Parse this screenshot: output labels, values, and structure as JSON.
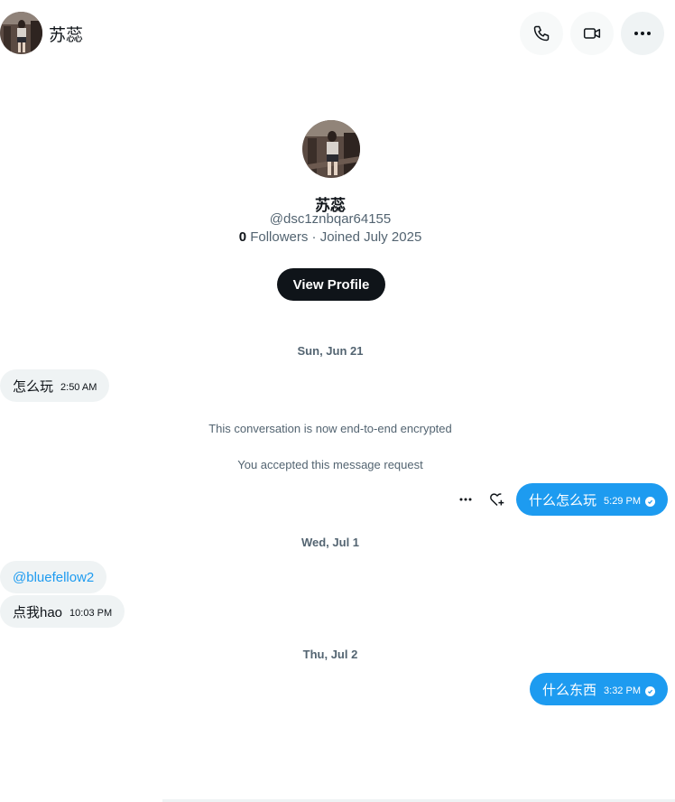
{
  "header": {
    "name": "苏蕊",
    "buttons": {
      "call": "phone-icon",
      "video": "video-icon",
      "more": "more-icon"
    }
  },
  "profile": {
    "name": "苏蕊",
    "handle": "@dsc1znbqar64155",
    "followers_count": "0",
    "followers_label": " Followers · Joined July 2025",
    "view_profile_label": "View Profile"
  },
  "dates": {
    "d1": "Sun, Jun 21",
    "d2": "Wed, Jul 1",
    "d3": "Thu, Jul 2"
  },
  "system_notes": {
    "encrypted": "This conversation is now end-to-end encrypted",
    "accepted": "You accepted this message request"
  },
  "messages": [
    {
      "text": "怎么玩",
      "time": "2:50 AM",
      "direction": "in"
    },
    {
      "text": "什么怎么玩",
      "time": "5:29 PM",
      "direction": "out"
    },
    {
      "text": "@bluefellow2",
      "time": "",
      "direction": "in"
    },
    {
      "text": "点我hao",
      "time": "10:03 PM",
      "direction": "in"
    },
    {
      "text": "什么东西",
      "time": "3:32 PM",
      "direction": "out"
    }
  ],
  "colors": {
    "accent": "#1d9bf0",
    "bubble_in": "#eff3f4",
    "text_primary": "#0f1419",
    "text_secondary": "#536471"
  }
}
